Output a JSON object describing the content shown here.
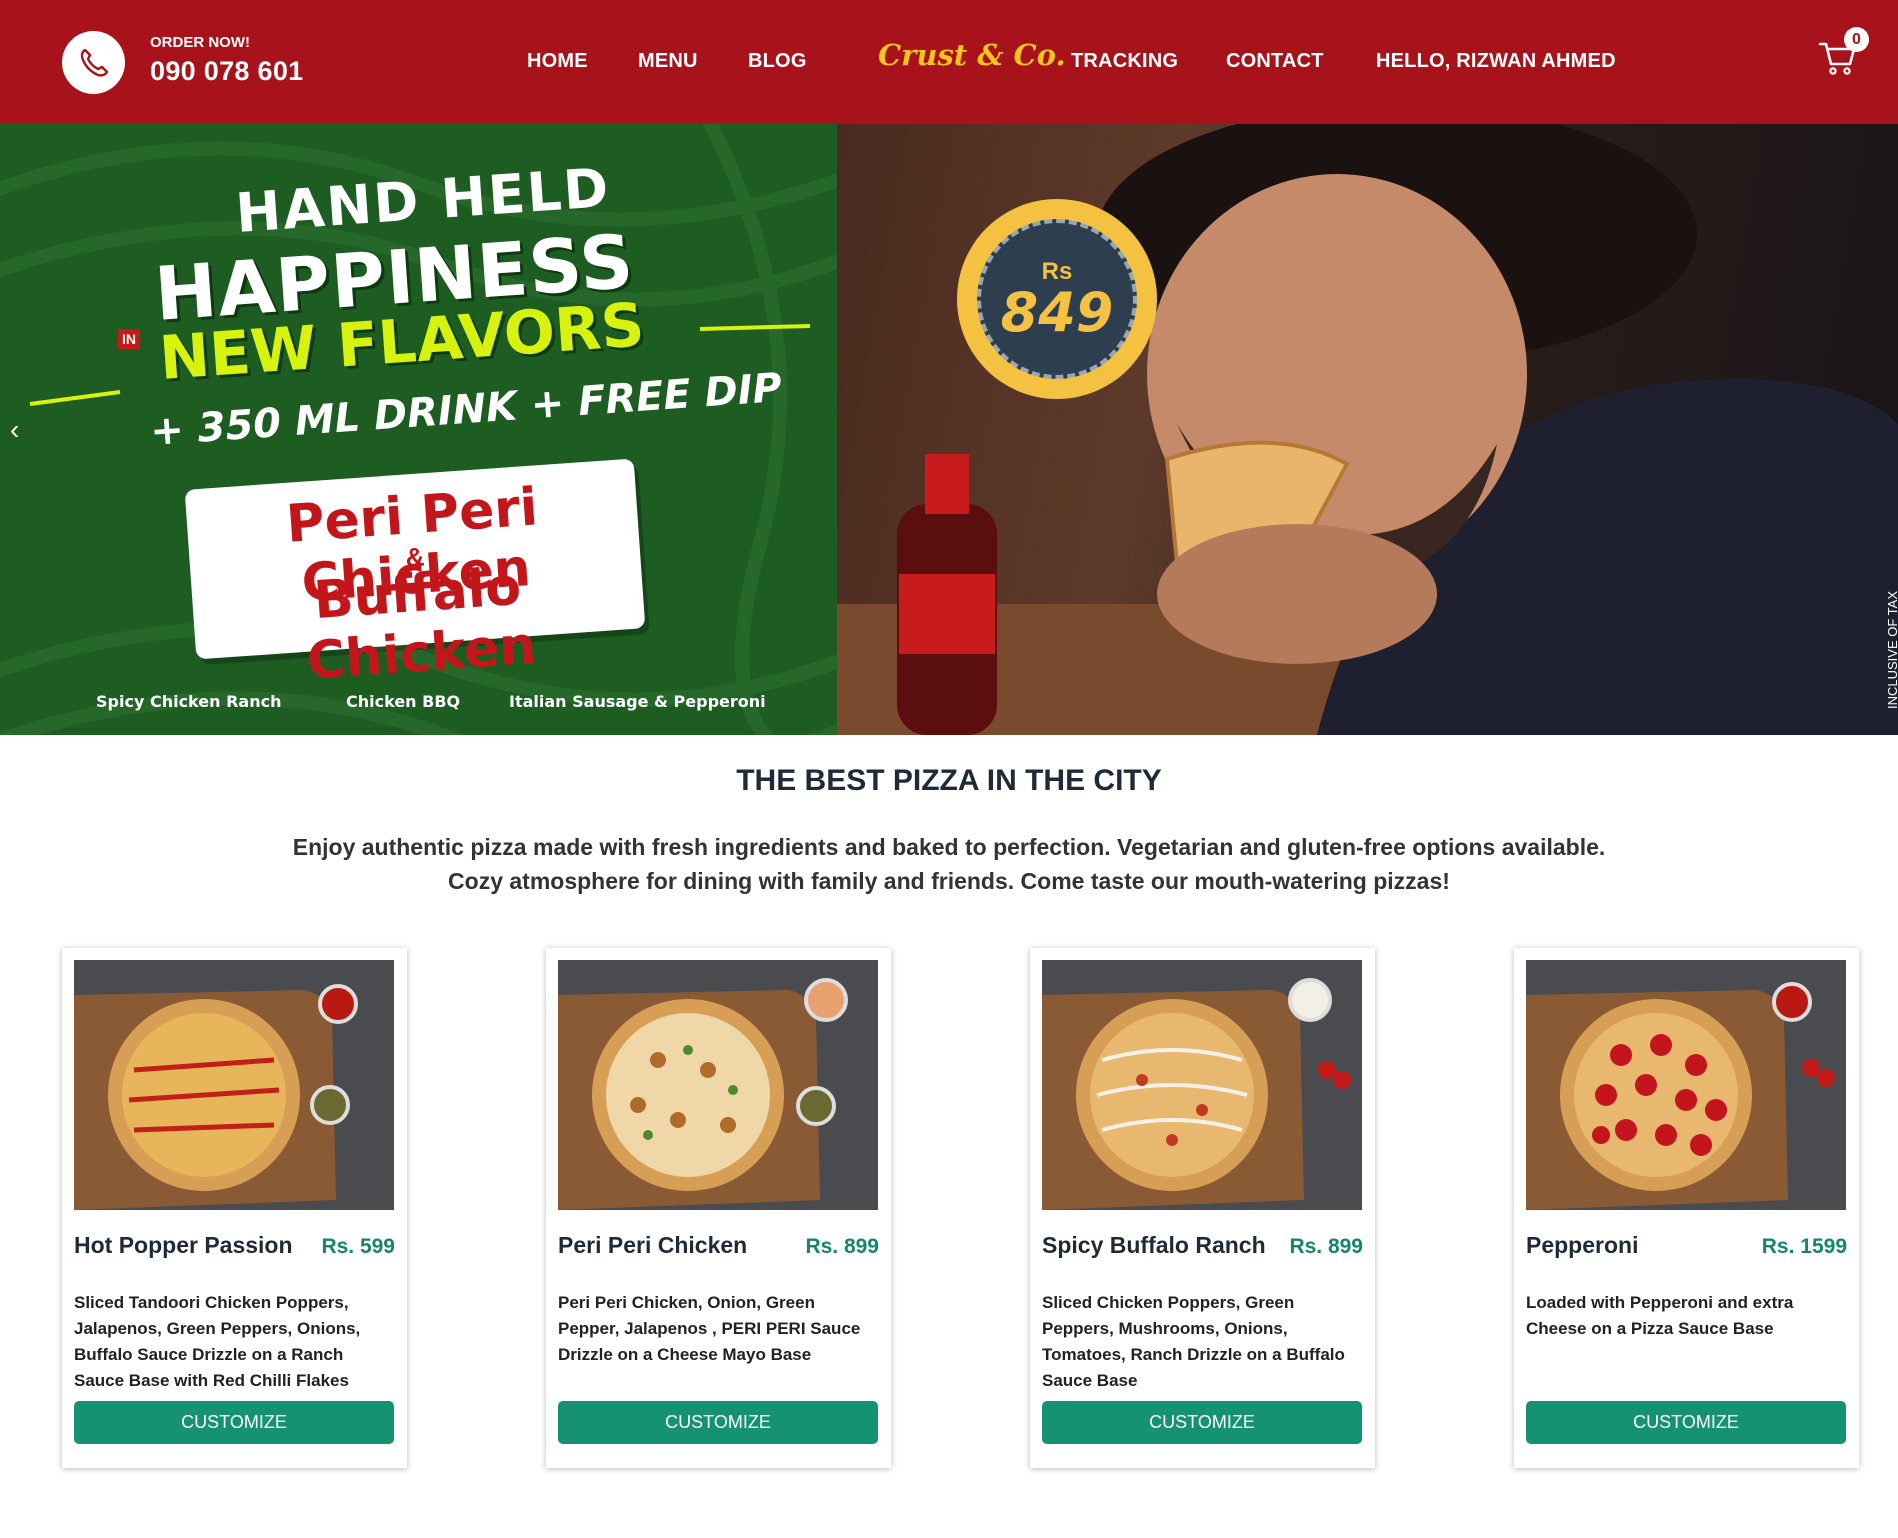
{
  "header": {
    "order_label": "ORDER NOW!",
    "phone": "090 078 601",
    "logo": "Crust & Co.",
    "nav": {
      "home": "HOME",
      "menu": "MENU",
      "blog": "BLOG",
      "tracking": "TRACKING",
      "contact": "CONTACT",
      "user": "HELLO, RIZWAN AHMED"
    },
    "cart_count": "0",
    "icons": {
      "phone": "phone-icon",
      "cart": "cart-icon"
    },
    "colors": {
      "bar": "#a8121a",
      "logo": "#f5c518"
    }
  },
  "hero": {
    "prev_arrow": "‹",
    "headline_1": "HAND HELD",
    "headline_in": "IN",
    "headline_2": "HAPPINESS",
    "headline_3": "NEW FLAVORS",
    "headline_4": "+ 350 ML DRINK + FREE DIP",
    "promo_line_1": "Peri Peri Chicken",
    "promo_amp": "&",
    "promo_line_2": "Buffalo Chicken",
    "flavors": [
      "Spicy Chicken Ranch",
      "Chicken BBQ",
      "Italian Sausage & Pepperoni"
    ],
    "price_currency": "Rs",
    "price_value": "849",
    "tax_note": "INCLUSIVE OF TAX",
    "colors": {
      "green": "#1e5d22",
      "lime": "#d7f20d",
      "badge": "#f5c140"
    }
  },
  "section": {
    "title": "THE BEST PIZZA IN THE CITY",
    "desc_line_1": "Enjoy authentic pizza made with fresh ingredients and baked to perfection. Vegetarian and gluten-free options available.",
    "desc_line_2": "Cozy atmosphere for dining with family and friends. Come taste our mouth-watering pizzas!"
  },
  "products": [
    {
      "name": "Hot Popper Passion",
      "price": "Rs. 599",
      "desc": "Sliced Tandoori Chicken Poppers, Jalapenos, Green Peppers, Onions, Buffalo Sauce Drizzle on a Ranch Sauce Base with Red Chilli Flakes",
      "button": "CUSTOMIZE"
    },
    {
      "name": "Peri Peri Chicken",
      "price": "Rs. 899",
      "desc": "Peri Peri Chicken, Onion, Green Pepper, Jalapenos , PERI PERI Sauce Drizzle on a Cheese Mayo Base",
      "button": "CUSTOMIZE"
    },
    {
      "name": "Spicy Buffalo Ranch",
      "price": "Rs. 899",
      "desc": "Sliced Chicken Poppers, Green Peppers, Mushrooms, Onions, Tomatoes, Ranch Drizzle on a Buffalo Sauce Base",
      "button": "CUSTOMIZE"
    },
    {
      "name": "Pepperoni",
      "price": "Rs. 1599",
      "desc": "Loaded with Pepperoni and extra Cheese on a Pizza Sauce Base",
      "button": "CUSTOMIZE"
    }
  ],
  "colors": {
    "accent_green": "#149271",
    "price_green": "#14876a"
  }
}
